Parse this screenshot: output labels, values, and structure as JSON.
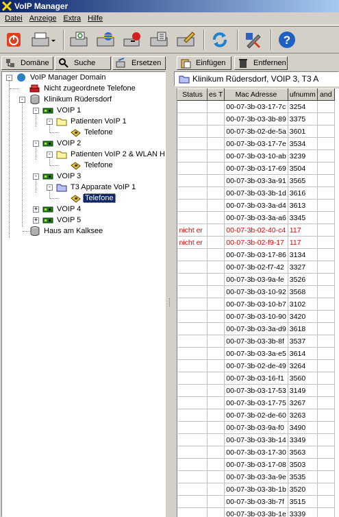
{
  "window": {
    "title": "VoIP Manager"
  },
  "menu": [
    {
      "label": "Datei"
    },
    {
      "label": "Anzeige"
    },
    {
      "label": "Extra"
    },
    {
      "label": "Hilfe"
    }
  ],
  "left_buttons": {
    "domain": "Domäne",
    "search": "Suche",
    "replace": "Ersetzen"
  },
  "right_buttons": {
    "insert": "Einfügen",
    "remove": "Entfernen"
  },
  "tree": {
    "root": "VoIP Manager Domain",
    "unassigned": "Nicht zugeordnete Telefone",
    "site1": "Klinikum Rüdersdorf",
    "voip1": "VOIP 1",
    "voip1_group": "Patienten VoIP 1",
    "voip1_phones": "Telefone",
    "voip2": "VOIP 2",
    "voip2_group": "Patienten VoIP 2 & WLAN H",
    "voip2_phones": "Telefone",
    "voip3": "VOIP 3",
    "voip3_group": "T3 Apparate VoIP 1",
    "voip3_phones": "Telefone",
    "voip4": "VOIP 4",
    "voip5": "VOIP 5",
    "site2": "Haus am Kalksee"
  },
  "path": "Klinikum Rüdersdorf, VOIP 3, T3 A",
  "table": {
    "headers": [
      "Status",
      "es T",
      "Mac Adresse",
      "ufnumm",
      "and"
    ],
    "rows": [
      [
        "",
        "",
        "00-07-3b-03-17-7c",
        "3254"
      ],
      [
        "",
        "",
        "00-07-3b-03-3b-89",
        "3375"
      ],
      [
        "",
        "",
        "00-07-3b-02-de-5a",
        "3601"
      ],
      [
        "",
        "",
        "00-07-3b-03-17-7e",
        "3534"
      ],
      [
        "",
        "",
        "00-07-3b-03-10-ab",
        "3239"
      ],
      [
        "",
        "",
        "00-07-3b-03-17-69",
        "3504"
      ],
      [
        "",
        "",
        "00-07-3b-03-3a-91",
        "3565"
      ],
      [
        "",
        "",
        "00-07-3b-03-3b-1d",
        "3616"
      ],
      [
        "",
        "",
        "00-07-3b-03-3a-d4",
        "3613"
      ],
      [
        "",
        "",
        "00-07-3b-03-3a-a6",
        "3345"
      ],
      [
        "nicht er",
        "",
        "00-07-3b-02-40-c4",
        "117"
      ],
      [
        "nicht er",
        "",
        "00-07-3b-02-f9-17",
        "117"
      ],
      [
        "",
        "",
        "00-07-3b-03-17-86",
        "3134"
      ],
      [
        "",
        "",
        "00-07-3b-02-f7-42",
        "3327"
      ],
      [
        "",
        "",
        "00-07-3b-03-9a-fe",
        "3526"
      ],
      [
        "",
        "",
        "00-07-3b-03-10-92",
        "3568"
      ],
      [
        "",
        "",
        "00-07-3b-03-10-b7",
        "3102"
      ],
      [
        "",
        "",
        "00-07-3b-03-10-90",
        "3420"
      ],
      [
        "",
        "",
        "00-07-3b-03-3a-d9",
        "3618"
      ],
      [
        "",
        "",
        "00-07-3b-03-3b-8f",
        "3537"
      ],
      [
        "",
        "",
        "00-07-3b-03-3a-e5",
        "3614"
      ],
      [
        "",
        "",
        "00-07-3b-02-de-49",
        "3264"
      ],
      [
        "",
        "",
        "00-07-3b-03-16-f1",
        "3560"
      ],
      [
        "",
        "",
        "00-07-3b-03-17-53",
        "3149"
      ],
      [
        "",
        "",
        "00-07-3b-03-17-75",
        "3267"
      ],
      [
        "",
        "",
        "00-07-3b-02-de-60",
        "3263"
      ],
      [
        "",
        "",
        "00-07-3b-03-9a-f0",
        "3490"
      ],
      [
        "",
        "",
        "00-07-3b-03-3b-14",
        "3349"
      ],
      [
        "",
        "",
        "00-07-3b-03-17-30",
        "3563"
      ],
      [
        "",
        "",
        "00-07-3b-03-17-08",
        "3503"
      ],
      [
        "",
        "",
        "00-07-3b-03-3a-9e",
        "3535"
      ],
      [
        "",
        "",
        "00-07-3b-03-3b-1b",
        "3520"
      ],
      [
        "",
        "",
        "00-07-3b-03-3b-7f",
        "3515"
      ],
      [
        "",
        "",
        "00-07-3b-03-3b-1e",
        "3339"
      ]
    ]
  },
  "colors": {
    "title_start": "#0a246a",
    "title_end": "#a6caf0",
    "error": "#e00000",
    "selection": "#0a246a"
  }
}
